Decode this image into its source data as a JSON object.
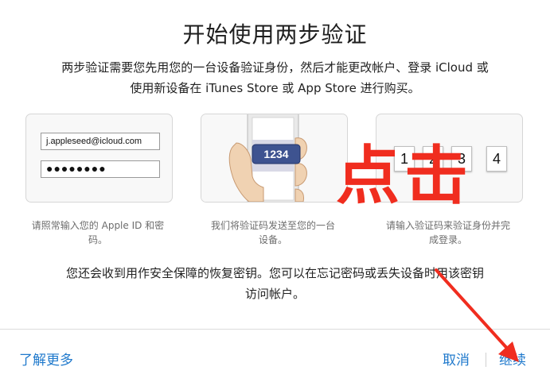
{
  "dialog": {
    "title": "开始使用两步验证",
    "intro_line1": "两步验证需要您先用您的一台设备验证身份，然后才能更改帐户、登录 iCloud 或",
    "intro_line2": "使用新设备在 iTunes Store 或 App Store 进行购买。"
  },
  "panels": {
    "signin": {
      "apple_id": "j.appleseed@icloud.com",
      "password_mask": "●●●●●●●●",
      "caption_line1": "请照常输入您的 Apple ID 和密",
      "caption_line2": "码。"
    },
    "send_code": {
      "code": "1234",
      "caption_line1": "我们将验证码发送至您的一台",
      "caption_line2": "设备。"
    },
    "enter_code": {
      "digits": [
        "1",
        "2",
        "3",
        "4"
      ],
      "caption_line1": "请输入验证码来验证身份并完",
      "caption_line2": "成登录。"
    }
  },
  "annotation": {
    "text": "点击",
    "color": "#f02d1f"
  },
  "backup": {
    "line1": "您还会收到用作安全保障的恢复密钥。您可以在忘记密码或丢失设备时用该密钥",
    "line2": "访问帐户。"
  },
  "footer": {
    "learn_more": "了解更多",
    "cancel": "取消",
    "continue": "继续",
    "link_color": "#1f79cc"
  }
}
